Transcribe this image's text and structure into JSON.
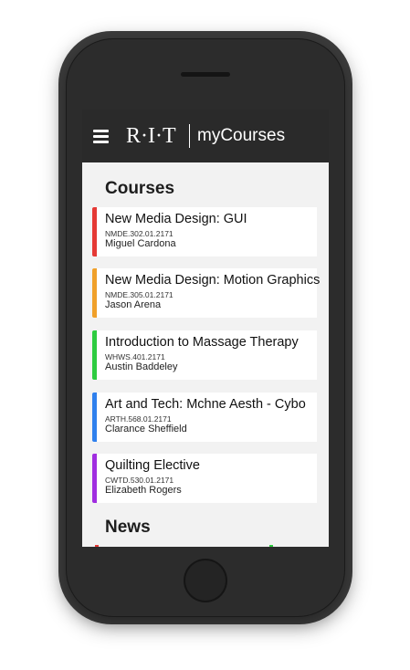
{
  "app": {
    "logo_text": "R·I·T",
    "title": "myCourses",
    "menu_icon": "hamburger-icon"
  },
  "sections": {
    "courses": "Courses",
    "news": "News"
  },
  "courses": [
    {
      "title": "New Media Design: GUI",
      "code": "NMDE.302.01.2171",
      "instructor": "Miguel Cardona",
      "color": "#e53935"
    },
    {
      "title": "New Media Design: Motion Graphics",
      "code": "NMDE.305.01.2171",
      "instructor": "Jason Arena",
      "color": "#f0a02a"
    },
    {
      "title": "Introduction to Massage Therapy",
      "code": "WHWS.401.2171",
      "instructor": "Austin Baddeley",
      "color": "#2ecc40"
    },
    {
      "title": "Art and Tech: Mchne Aesth - Cybo",
      "code": "ARTH.568.01.2171",
      "instructor": "Clarance Sheffield",
      "color": "#2f80ed"
    },
    {
      "title": "Quilting Elective",
      "code": "CWTD.530.01.2171",
      "instructor": "Elizabeth Rogers",
      "color": "#a02ee0"
    }
  ],
  "colors": {
    "appbar": "#2a2a2a",
    "screen_bg": "#f2f2f2",
    "phone_body": "#2c2c2c"
  }
}
